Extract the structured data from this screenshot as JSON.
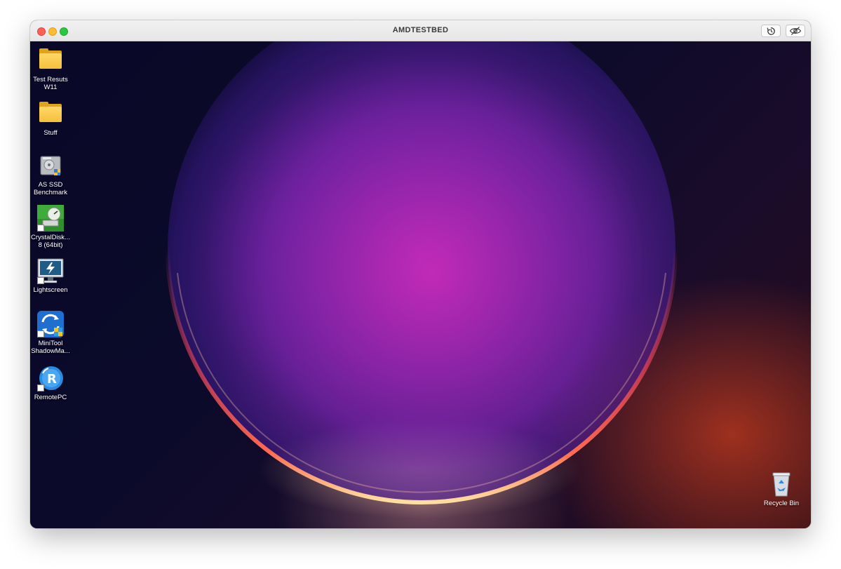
{
  "window": {
    "title": "AMDTESTBED"
  },
  "toolbar": {
    "restart_icon": "restart-icon",
    "hide_icon": "eye-slash-icon"
  },
  "desktop": {
    "icons": [
      {
        "label": "Test Resuts W11",
        "icon": "folder-icon"
      },
      {
        "label": "Stuff",
        "icon": "folder-icon"
      },
      {
        "label": "AS SSD Benchmark",
        "icon": "drive-icon"
      },
      {
        "label": "CrystalDisk... 8 (64bit)",
        "icon": "disk-gauge-icon"
      },
      {
        "label": "Lightscreen",
        "icon": "monitor-icon"
      },
      {
        "label": "MiniTool ShadowMa...",
        "icon": "shadowmaker-icon"
      },
      {
        "label": "RemotePC",
        "icon": "remotepc-icon"
      }
    ],
    "recycle_bin": {
      "label": "Recycle Bin",
      "icon": "recycle-bin-icon"
    }
  },
  "colors": {
    "close": "#fe5f57",
    "minimize": "#febc2e",
    "maximize": "#28c840"
  }
}
